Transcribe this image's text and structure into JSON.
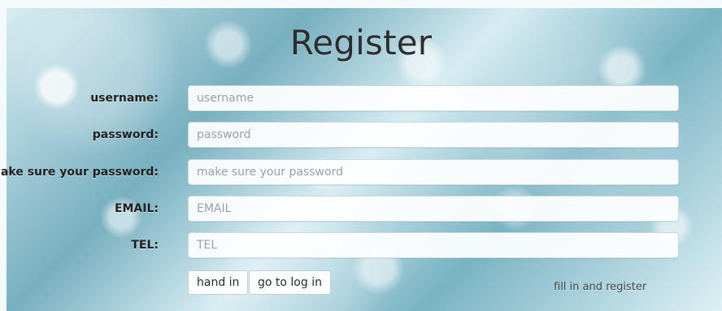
{
  "title": "Register",
  "fields": [
    {
      "label": "username:",
      "placeholder": "username"
    },
    {
      "label": "password:",
      "placeholder": "password"
    },
    {
      "label": "make sure your password:",
      "placeholder": "make sure your password"
    },
    {
      "label": "EMAIL:",
      "placeholder": "EMAIL"
    },
    {
      "label": "TEL:",
      "placeholder": "TEL"
    }
  ],
  "buttons": {
    "submit_label": "hand in",
    "login_label": "go to log in"
  },
  "hint": "fill in and register"
}
